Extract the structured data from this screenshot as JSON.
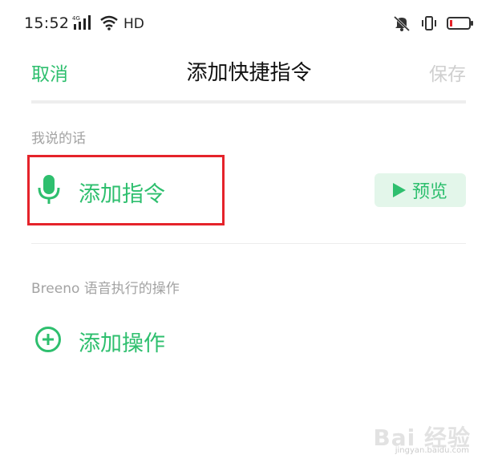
{
  "status_bar": {
    "time": "15:52",
    "network": "4G",
    "hd": "HD"
  },
  "header": {
    "cancel_label": "取消",
    "title": "添加快捷指令",
    "save_label": "保存"
  },
  "sections": {
    "phrase_label": "我说的话",
    "add_command_label": "添加指令",
    "preview_label": "预览",
    "actions_label": "Breeno 语音执行的操作",
    "add_action_label": "添加操作"
  },
  "watermark": {
    "brand": "Bai 经验",
    "url": "jingyan.baidu.com"
  },
  "colors": {
    "accent": "#2ebf6e",
    "preview_bg": "#e3f6ea",
    "disabled": "#cfcfcf",
    "annotation": "#e5232a"
  }
}
